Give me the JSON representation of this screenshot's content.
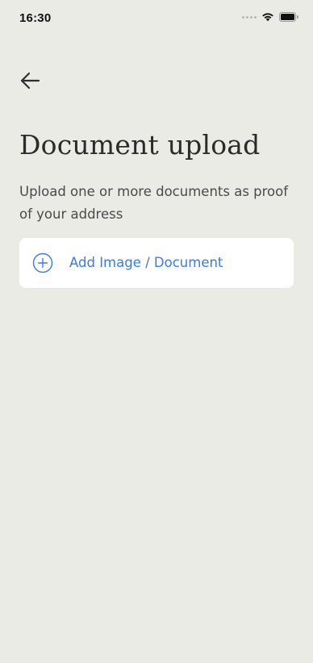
{
  "status_bar": {
    "time": "16:30"
  },
  "icons": {
    "back": "arrow-left-icon",
    "add": "plus-circle-icon",
    "wifi": "wifi-icon",
    "battery": "battery-icon"
  },
  "page": {
    "title": "Document upload",
    "description": "Upload one or more documents as proof of your address"
  },
  "upload": {
    "label": "Add Image / Document"
  },
  "colors": {
    "background": "#ebebe6",
    "card": "#ffffff",
    "accent": "#3d7be0",
    "title": "#2b2b2b",
    "body_text": "#4a4a4a"
  }
}
